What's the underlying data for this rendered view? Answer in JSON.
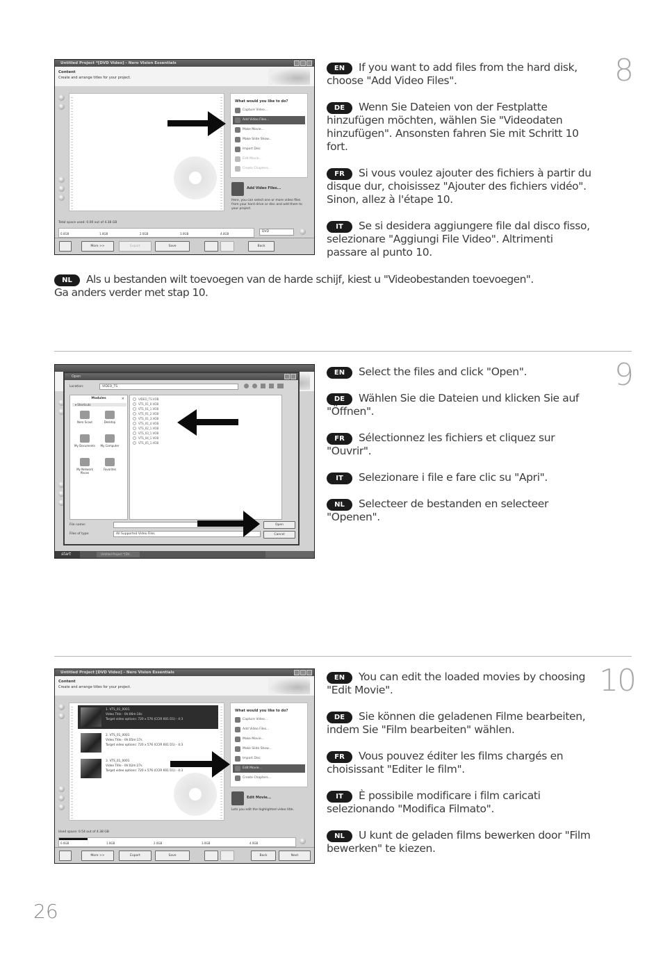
{
  "page_number": "26",
  "steps": [
    {
      "number": "8",
      "instructions": [
        {
          "lang": "EN",
          "text": "If you want to add files from the hard disk, choose \"Add Video Files\"."
        },
        {
          "lang": "DE",
          "text": "Wenn Sie Dateien von der Festplatte hinzufügen möchten, wählen Sie \"Videodaten hinzufügen\". Ansonsten fahren Sie mit Schritt 10 fort."
        },
        {
          "lang": "FR",
          "text": "Si vous voulez ajouter des fichiers à partir du disque dur, choisissez \"Ajouter des fichiers vidéo\". Sinon, allez à l'étape 10."
        },
        {
          "lang": "IT",
          "text": "Se si desidera aggiungere file dal disco fisso, selezionare \"Aggiungi File Video\". Altrimenti passare al punto 10."
        },
        {
          "lang": "NL",
          "text": "Als u bestanden wilt toevoegen van de harde schijf, kiest u \"Videobestanden toevoegen\".",
          "text2": "Ga anders verder met stap 10."
        }
      ],
      "screenshot": {
        "title": "Untitled Project *[DVD Video] - Nero Vision Essentials",
        "section_title": "Content",
        "section_subtitle": "Create and arrange titles for your project.",
        "task_question": "What would you like to do?",
        "tasks": [
          {
            "label": "Capture Video...",
            "state": "normal"
          },
          {
            "label": "Add Video Files...",
            "state": "selected"
          },
          {
            "label": "Make Movie...",
            "state": "normal"
          },
          {
            "label": "Make Slide Show...",
            "state": "normal"
          },
          {
            "label": "Import Disc",
            "state": "normal"
          },
          {
            "label": "Edit Movie...",
            "state": "disabled"
          },
          {
            "label": "Create Chapters...",
            "state": "disabled"
          }
        ],
        "action_title": "Add Video Files...",
        "action_description": "Here, you can select one or more video files from your hard drive or disc and add them to your project.",
        "space_label": "Total space used: 0.00 out of 4.38 GB",
        "scale_ticks": [
          "0.0GB",
          "1.0GB",
          "2.0GB",
          "3.0GB",
          "4.0GB"
        ],
        "disc_type": "DVD",
        "buttons": {
          "more": "More >>",
          "export": "Export",
          "save": "Save",
          "back": "Back"
        }
      }
    },
    {
      "number": "9",
      "instructions": [
        {
          "lang": "EN",
          "text": "Select the files and click \"Open\"."
        },
        {
          "lang": "DE",
          "text": "Wählen Sie die Dateien und klicken Sie auf \"Öffnen\"."
        },
        {
          "lang": "FR",
          "text": "Sélectionnez les fichiers et cliquez sur \"Ouvrir\"."
        },
        {
          "lang": "IT",
          "text": "Selezionare i file e fare clic su \"Apri\"."
        },
        {
          "lang": "NL",
          "text": "Selecteer de bestanden en selecteer \"Openen\"."
        }
      ],
      "screenshot": {
        "dialog_title": "Open",
        "location_label": "Location:",
        "location_value": "VIDEO_TS",
        "modules_title": "Modules",
        "shortcuts_label": "Shortcuts",
        "shortcuts": [
          "Nero Scout",
          "Desktop",
          "My Documents",
          "My Computer",
          "My Network Places",
          "Favorites"
        ],
        "files": [
          "VIDEO_TS.VOB",
          "VTS_01_0.VOB",
          "VTS_01_1.VOB",
          "VTS_01_2.VOB",
          "VTS_01_3.VOB",
          "VTS_01_4.VOB",
          "VTS_02_1.VOB",
          "VTS_03_1.VOB",
          "VTS_04_1.VOB",
          "VTS_05_1.VOB"
        ],
        "filename_label": "File name:",
        "filename_value": "",
        "filetype_label": "Files of type:",
        "filetype_value": "All Supported Video Files",
        "open_button": "Open",
        "cancel_button": "Cancel",
        "taskbar_start": "start",
        "taskbar_item": "Untitled Project *[DV..."
      }
    },
    {
      "number": "10",
      "instructions": [
        {
          "lang": "EN",
          "text": "You can edit the loaded movies by choosing \"Edit Movie\"."
        },
        {
          "lang": "DE",
          "text": "Sie können die geladenen Filme bearbeiten, indem Sie \"Film bearbeiten\" wählen."
        },
        {
          "lang": "FR",
          "text": "Vous pouvez éditer les films chargés en choisissant \"Editer le film\"."
        },
        {
          "lang": "IT",
          "text": "È possibile modificare i film caricati selezionando \"Modifica Filmato\"."
        },
        {
          "lang": "NL",
          "text": "U kunt de geladen films bewerken door \"Film bewerken\" te kiezen."
        }
      ],
      "screenshot": {
        "title": "Untitled Project [DVD Video] - Nero Vision Essentials",
        "section_title": "Content",
        "section_subtitle": "Create and arrange titles for your project.",
        "clips": [
          {
            "name": "1. VTS_01_0001",
            "duration": "Video Title - 0h:06m:10s",
            "options": "Target video options: 720 x 576 (CCIR 601 D1) - 4:3",
            "selected": true
          },
          {
            "name": "2. VTS_01_0001",
            "duration": "Video Title - 0h:05m:17s",
            "options": "Target video options: 720 x 576 (CCIR 601 D1) - 4:3",
            "selected": false
          },
          {
            "name": "3. VTS_01_0001",
            "duration": "Video Title - 0h:02m:27s",
            "options": "Target video options: 720 x 576 (CCIR 601 D1) - 4:3",
            "selected": false
          }
        ],
        "task_question": "What would you like to do?",
        "tasks": [
          {
            "label": "Capture Video...",
            "state": "normal"
          },
          {
            "label": "Add Video Files...",
            "state": "normal"
          },
          {
            "label": "Make Movie...",
            "state": "normal"
          },
          {
            "label": "Make Slide Show...",
            "state": "normal"
          },
          {
            "label": "Import Disc",
            "state": "normal"
          },
          {
            "label": "Edit Movie...",
            "state": "selected"
          },
          {
            "label": "Create Chapters...",
            "state": "normal"
          }
        ],
        "action_title": "Edit Movie...",
        "action_description": "Lets you edit the highlighted video title.",
        "space_label": "Used space: 0.54 out of 4.38 GB",
        "space_used_fraction": 0.12,
        "scale_ticks": [
          "0.0GB",
          "1.0GB",
          "2.0GB",
          "3.0GB",
          "4.0GB"
        ],
        "buttons": {
          "more": "More >>",
          "export": "Export",
          "save": "Save",
          "back": "Back",
          "next": "Next"
        }
      }
    }
  ]
}
